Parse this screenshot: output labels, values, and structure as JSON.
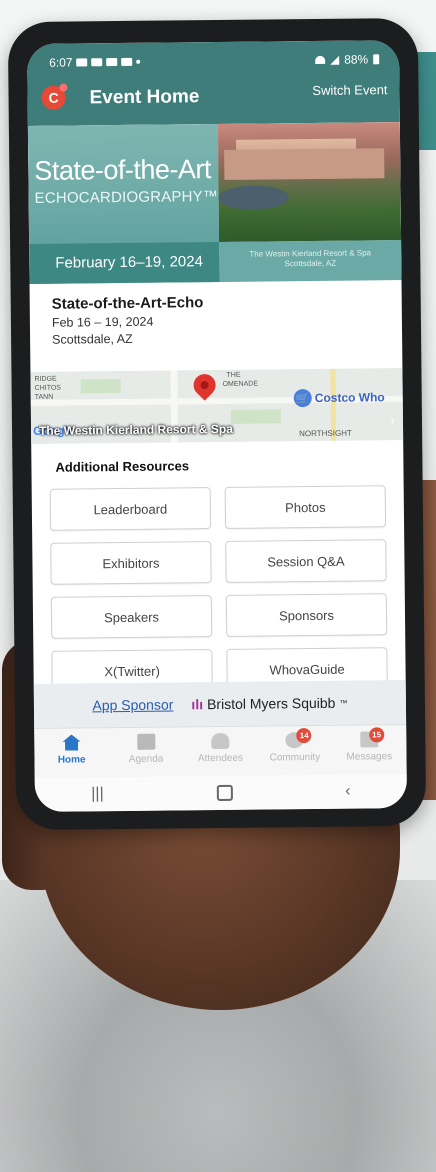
{
  "status": {
    "time": "6:07",
    "battery": "88%"
  },
  "header": {
    "title": "Event Home",
    "switch_label": "Switch Event"
  },
  "banner": {
    "title_line1": "State-of-the-Art",
    "title_line2": "ECHOCARDIOGRAPHY™",
    "dates": "February 16–19, 2024",
    "venue_line1": "The Westin Kierland Resort & Spa",
    "venue_line2": "Scottsdale, AZ"
  },
  "event": {
    "name": "State-of-the-Art-Echo",
    "dates": "Feb 16 – 19, 2024",
    "location": "Scottsdale, AZ"
  },
  "map": {
    "venue_label": "The Westin Kierland Resort & Spa",
    "poi_costco": "Costco Who",
    "label_promenade_1": "THE",
    "label_promenade_2": "OMENADE",
    "label_left_1": "RIDGE",
    "label_left_2": "CHITOS",
    "label_left_3": "TANN",
    "label_northsight": "NORTHSIGHT",
    "google": "Google"
  },
  "resources": {
    "title": "Additional Resources",
    "buttons": [
      "Leaderboard",
      "Photos",
      "Exhibitors",
      "Session Q&A",
      "Speakers",
      "Sponsors",
      "X(Twitter)",
      "WhovaGuide"
    ]
  },
  "sponsor": {
    "link_label": "App Sponsor",
    "name": "Bristol Myers Squibb",
    "mark": "™"
  },
  "tabs": [
    {
      "label": "Home",
      "active": true
    },
    {
      "label": "Agenda",
      "active": false
    },
    {
      "label": "Attendees",
      "active": false
    },
    {
      "label": "Community",
      "active": false,
      "badge": "14"
    },
    {
      "label": "Messages",
      "active": false,
      "badge": "15"
    }
  ],
  "colors": {
    "header": "#3e7d7a",
    "active_tab": "#2a77c8",
    "badge": "#e14b3a"
  }
}
